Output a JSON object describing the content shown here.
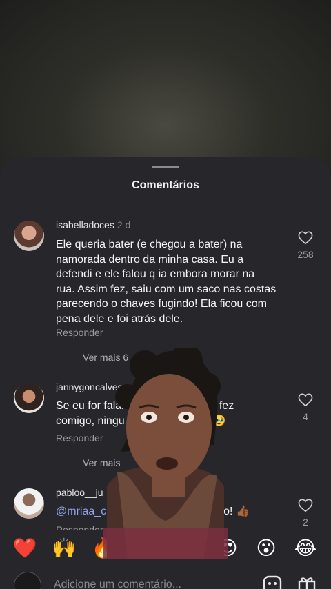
{
  "sheet": {
    "title": "Comentários"
  },
  "comments": [
    {
      "username": "isabelladoces",
      "ago": "2 d",
      "text": "Ele queria bater (e chegou a bater) na namorada dentro da minha casa. Eu a defendi e ele falou q ia embora morar na rua. Assim fez, saiu com um saco nas costas parecendo o chaves fugindo! Ela ficou com pena dele e foi atrás dele.",
      "reply": "Responder",
      "more": "Ver mais 6",
      "likes": "258"
    },
    {
      "username": "jannygoncalves",
      "text_start": "Se eu for falar",
      "text_mid": "mã\" fez",
      "text_line2": "comigo, ningu",
      "text_end": "a🥹",
      "reply": "Responder",
      "more": "Ver mais",
      "likes": "4"
    },
    {
      "username": "pabloo__ju",
      "mention": "@mriaa_c",
      "text_end": "o! 👍🏾",
      "reply": "Responder",
      "likes": "2"
    }
  ],
  "emojis": [
    "❤️",
    "🙌",
    "🔥",
    "👏",
    "😢",
    "😍",
    "😮",
    "😂"
  ],
  "bottom": {
    "placeholder": "Adicione um comentário..."
  },
  "colors": {
    "sheet_bg": "#26262b",
    "mention": "#8fa3e8"
  }
}
